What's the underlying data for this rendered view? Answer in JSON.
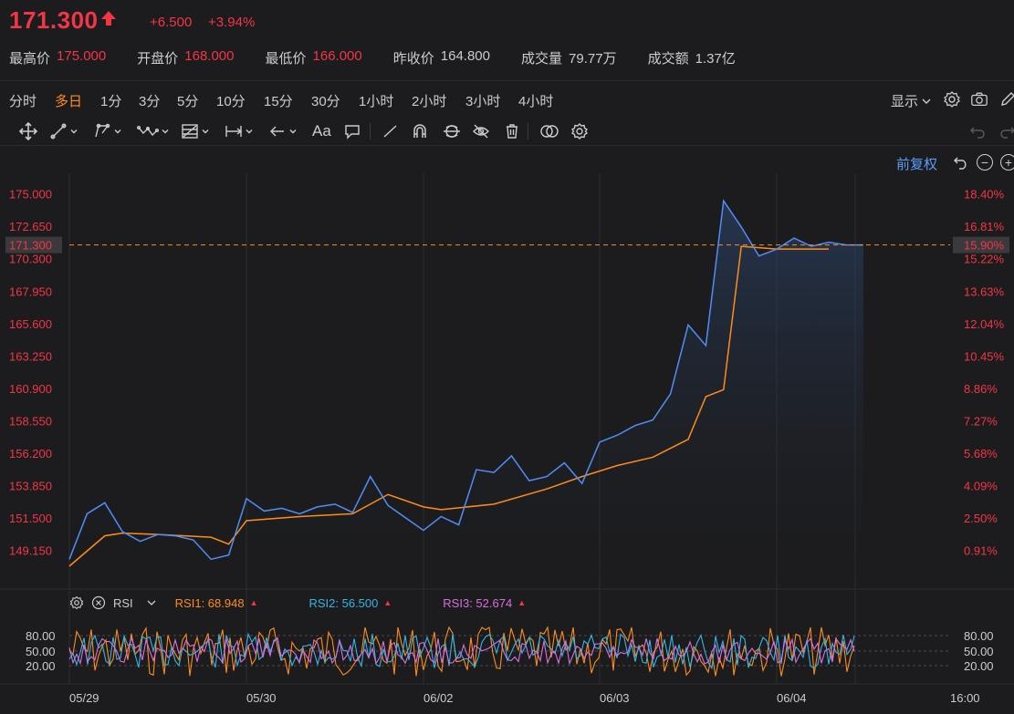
{
  "quote": {
    "price": "171.300",
    "change": "+6.500",
    "change_pct": "+3.94%",
    "stats": [
      {
        "label": "最高价",
        "value": "175.000",
        "color": "red"
      },
      {
        "label": "开盘价",
        "value": "168.000",
        "color": "red"
      },
      {
        "label": "最低价",
        "value": "166.000",
        "color": "red"
      },
      {
        "label": "昨收价",
        "value": "164.800",
        "color": "neutral"
      },
      {
        "label": "成交量",
        "value": "79.77万",
        "color": "neutral"
      },
      {
        "label": "成交额",
        "value": "1.37亿",
        "color": "neutral"
      }
    ]
  },
  "timeframes": [
    "分时",
    "多日",
    "1分",
    "3分",
    "5分",
    "10分",
    "15分",
    "30分",
    "1小时",
    "2小时",
    "3小时",
    "4小时"
  ],
  "active_timeframe": "多日",
  "toolbar": {
    "display_label": "显示"
  },
  "chart": {
    "adjust_label": "前复权"
  },
  "colors": {
    "up": "#f23645",
    "accent": "#ff8c1a",
    "price_line": "#4f8ef7",
    "avg_line": "#ff8c1a",
    "rsi1": "#ff8c1a",
    "rsi2": "#33b5e5",
    "rsi3": "#d670e0"
  },
  "rsi": {
    "label": "RSI",
    "rsi1": "RSI1: 68.948",
    "rsi2": "RSI2: 56.500",
    "rsi3": "RSI3: 52.674",
    "levels": [
      "80.00",
      "50.00",
      "20.00"
    ]
  },
  "chart_data": {
    "type": "line",
    "title": "",
    "y_ticks": [
      "175.000",
      "172.650",
      "170.300",
      "167.950",
      "165.600",
      "163.250",
      "160.900",
      "158.550",
      "156.200",
      "153.850",
      "151.500",
      "149.150"
    ],
    "y_tick_values": [
      175.0,
      172.65,
      170.3,
      167.95,
      165.6,
      163.25,
      160.9,
      158.55,
      156.2,
      153.85,
      151.5,
      149.15
    ],
    "pct_ticks": [
      "18.40%",
      "16.81%",
      "15.90%",
      "15.22%",
      "13.63%",
      "12.04%",
      "10.45%",
      "8.86%",
      "7.27%",
      "5.68%",
      "4.09%",
      "2.50%",
      "0.91%"
    ],
    "current_price_label": "171.300",
    "current_pct_label": "15.90%",
    "x_ticks": [
      "05/29",
      "05/30",
      "06/02",
      "06/03",
      "06/04",
      "16:00"
    ],
    "ylim": [
      147.0,
      176.5
    ],
    "series": [
      {
        "name": "price",
        "x": [
          0,
          0.1,
          0.2,
          0.3,
          0.4,
          0.5,
          0.6,
          0.7,
          0.8,
          0.9,
          1.0,
          1.1,
          1.2,
          1.3,
          1.4,
          1.5,
          1.6,
          1.7,
          1.8,
          1.9,
          2.0,
          2.1,
          2.2,
          2.3,
          2.4,
          2.5,
          2.6,
          2.7,
          2.8,
          2.9,
          3.0,
          3.1,
          3.2,
          3.3,
          3.4,
          3.5,
          3.6,
          3.7,
          3.8,
          3.9,
          4.0,
          4.1,
          4.2,
          4.3,
          4.4,
          4.5
        ],
        "values": [
          148.5,
          151.8,
          152.6,
          150.5,
          149.8,
          150.3,
          150.2,
          149.9,
          148.5,
          148.8,
          152.9,
          152.0,
          152.2,
          151.8,
          152.3,
          152.5,
          151.9,
          154.5,
          152.4,
          151.5,
          150.6,
          151.6,
          151.0,
          155.0,
          154.8,
          156.0,
          154.2,
          154.5,
          155.5,
          154.0,
          157.0,
          157.5,
          158.2,
          158.6,
          160.5,
          165.5,
          164.0,
          174.5,
          172.6,
          170.5,
          171.0,
          171.8,
          171.2,
          171.5,
          171.3,
          171.3
        ]
      },
      {
        "name": "average",
        "x": [
          0,
          0.2,
          0.3,
          0.5,
          0.8,
          0.9,
          1.0,
          1.3,
          1.6,
          1.8,
          2.0,
          2.1,
          2.4,
          2.7,
          2.9,
          3.1,
          3.3,
          3.5,
          3.6,
          3.7,
          3.8,
          4.0,
          4.3
        ],
        "values": [
          148.0,
          150.2,
          150.4,
          150.3,
          150.1,
          149.6,
          151.3,
          151.6,
          151.8,
          153.2,
          152.3,
          152.1,
          152.5,
          153.6,
          154.5,
          155.3,
          155.9,
          157.2,
          160.3,
          160.8,
          171.2,
          171.0,
          171.0
        ]
      }
    ]
  }
}
